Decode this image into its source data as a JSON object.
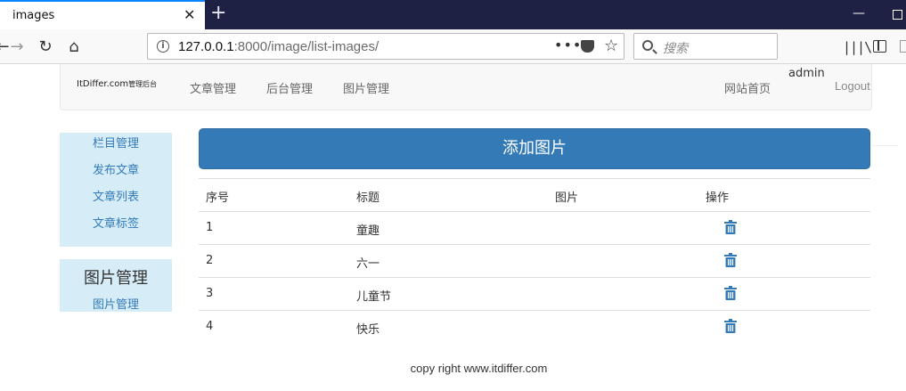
{
  "browser": {
    "tab_title": "images",
    "tab_close": "✕",
    "new_tab": "+",
    "url_host": "127.0.0.1",
    "url_rest": ":8000/image/list-images/",
    "url_more": "•••",
    "search_placeholder": "搜索",
    "icons": [
      "back-icon",
      "forward-icon",
      "reload-icon",
      "home-icon",
      "info-icon",
      "pocket-icon",
      "bookmark-star-icon",
      "search-icon",
      "library-icon",
      "sidebar-icon"
    ]
  },
  "site_nav": {
    "brand": "ItDiffer.com",
    "brand_suffix": "管理后台",
    "links": [
      "文章管理",
      "后台管理",
      "图片管理"
    ],
    "home_link": "网站首页",
    "username": "admin",
    "logout": "Logout"
  },
  "sidebar": {
    "article_links": [
      "栏目管理",
      "发布文章",
      "文章列表",
      "文章标签"
    ],
    "image_heading": "图片管理",
    "image_link": "图片管理"
  },
  "main": {
    "add_button": "添加图片",
    "columns": [
      "序号",
      "标题",
      "图片",
      "操作"
    ],
    "rows": [
      {
        "num": "1",
        "title": "童趣",
        "image": ""
      },
      {
        "num": "2",
        "title": "六一",
        "image": ""
      },
      {
        "num": "3",
        "title": "儿童节",
        "image": ""
      },
      {
        "num": "4",
        "title": "快乐",
        "image": ""
      }
    ],
    "row_action_icon": "trash-icon",
    "accent_color": "#337ab7"
  },
  "footer": "copy right www.itdiffer.com"
}
